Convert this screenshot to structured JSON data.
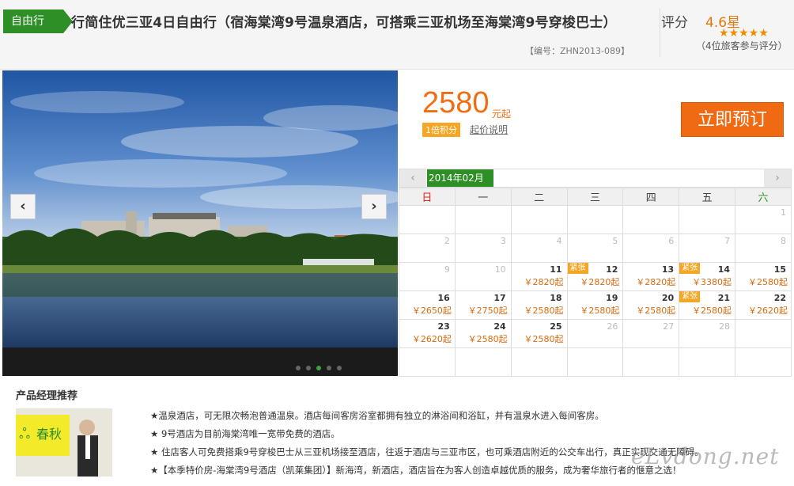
{
  "header": {
    "badge": "自由行",
    "title": "行简住优三亚4日自由行（宿海棠湾9号温泉酒店，可搭乘三亚机场至海棠湾9号穿梭巴士）",
    "code": "【编号：ZHN2013-089】",
    "rating_label": "评分",
    "rating_value": "4.6星",
    "rating_stars": "★★★★★",
    "rating_count": "（4位旅客参与评分）"
  },
  "gallery": {
    "prev_icon": "‹",
    "next_icon": "›"
  },
  "price": {
    "amount": "2580",
    "unit": "元起",
    "points_badge": "1倍积分",
    "note": "起价说明",
    "book_label": "立即预订"
  },
  "calendar": {
    "prev_icon": "‹",
    "next_icon": "›",
    "month": "2014年02月",
    "weekdays": [
      "日",
      "一",
      "二",
      "三",
      "四",
      "五",
      "六"
    ],
    "weeks": [
      [
        {
          "day": "",
          "past": false,
          "price": "",
          "tag": ""
        },
        {
          "day": "",
          "past": false,
          "price": "",
          "tag": ""
        },
        {
          "day": "",
          "past": false,
          "price": "",
          "tag": ""
        },
        {
          "day": "",
          "past": false,
          "price": "",
          "tag": ""
        },
        {
          "day": "",
          "past": false,
          "price": "",
          "tag": ""
        },
        {
          "day": "",
          "past": false,
          "price": "",
          "tag": ""
        },
        {
          "day": "1",
          "past": true,
          "price": "",
          "tag": ""
        }
      ],
      [
        {
          "day": "2",
          "past": true,
          "price": "",
          "tag": ""
        },
        {
          "day": "3",
          "past": true,
          "price": "",
          "tag": ""
        },
        {
          "day": "4",
          "past": true,
          "price": "",
          "tag": ""
        },
        {
          "day": "5",
          "past": true,
          "price": "",
          "tag": ""
        },
        {
          "day": "6",
          "past": true,
          "price": "",
          "tag": ""
        },
        {
          "day": "7",
          "past": true,
          "price": "",
          "tag": ""
        },
        {
          "day": "8",
          "past": true,
          "price": "",
          "tag": ""
        }
      ],
      [
        {
          "day": "9",
          "past": true,
          "price": "",
          "tag": ""
        },
        {
          "day": "10",
          "past": true,
          "price": "",
          "tag": ""
        },
        {
          "day": "11",
          "past": false,
          "price": "￥2820起",
          "tag": ""
        },
        {
          "day": "12",
          "past": false,
          "price": "￥2820起",
          "tag": "紧张"
        },
        {
          "day": "13",
          "past": false,
          "price": "￥2820起",
          "tag": ""
        },
        {
          "day": "14",
          "past": false,
          "price": "￥3380起",
          "tag": "紧张"
        },
        {
          "day": "15",
          "past": false,
          "price": "￥2580起",
          "tag": ""
        }
      ],
      [
        {
          "day": "16",
          "past": false,
          "price": "￥2650起",
          "tag": ""
        },
        {
          "day": "17",
          "past": false,
          "price": "￥2750起",
          "tag": ""
        },
        {
          "day": "18",
          "past": false,
          "price": "￥2580起",
          "tag": ""
        },
        {
          "day": "19",
          "past": false,
          "price": "￥2580起",
          "tag": ""
        },
        {
          "day": "20",
          "past": false,
          "price": "￥2580起",
          "tag": ""
        },
        {
          "day": "21",
          "past": false,
          "price": "￥2580起",
          "tag": "紧张"
        },
        {
          "day": "22",
          "past": false,
          "price": "￥2620起",
          "tag": ""
        }
      ],
      [
        {
          "day": "23",
          "past": false,
          "price": "￥2620起",
          "tag": ""
        },
        {
          "day": "24",
          "past": false,
          "price": "￥2580起",
          "tag": ""
        },
        {
          "day": "25",
          "past": false,
          "price": "￥2580起",
          "tag": ""
        },
        {
          "day": "26",
          "past": true,
          "price": "",
          "tag": ""
        },
        {
          "day": "27",
          "past": true,
          "price": "",
          "tag": ""
        },
        {
          "day": "28",
          "past": true,
          "price": "",
          "tag": ""
        },
        {
          "day": "",
          "past": false,
          "price": "",
          "tag": ""
        }
      ],
      [
        {
          "day": "",
          "past": false,
          "price": "",
          "tag": ""
        },
        {
          "day": "",
          "past": false,
          "price": "",
          "tag": ""
        },
        {
          "day": "",
          "past": false,
          "price": "",
          "tag": ""
        },
        {
          "day": "",
          "past": false,
          "price": "",
          "tag": ""
        },
        {
          "day": "",
          "past": false,
          "price": "",
          "tag": ""
        },
        {
          "day": "",
          "past": false,
          "price": "",
          "tag": ""
        },
        {
          "day": "",
          "past": false,
          "price": "",
          "tag": ""
        }
      ]
    ]
  },
  "manager": {
    "title": "产品经理推荐",
    "photo_sign": "春秋",
    "bullets": [
      "★温泉酒店，可无限次畅泡普通温泉。酒店每间客房浴室都拥有独立的淋浴间和浴缸，并有温泉水进入每间客房。",
      "★ 9号酒店为目前海棠湾唯一宽带免费的酒店。",
      "★ 住店客人可免费搭乘9号穿梭巴士从三亚机场接至酒店，往返于酒店与三亚市区，也可乘酒店附近的公交车出行，真正实现交通无障碍。",
      "★【本季特价房-海棠湾9号酒店（凯莱集团）】新海湾，新酒店，酒店旨在为客人创造卓越优质的服务，成为奢华旅行者的惬意之选！"
    ]
  },
  "watermark": "eLvdong.net",
  "colors": {
    "brand_green": "#2f8f27",
    "accent_orange": "#ef6a12"
  }
}
